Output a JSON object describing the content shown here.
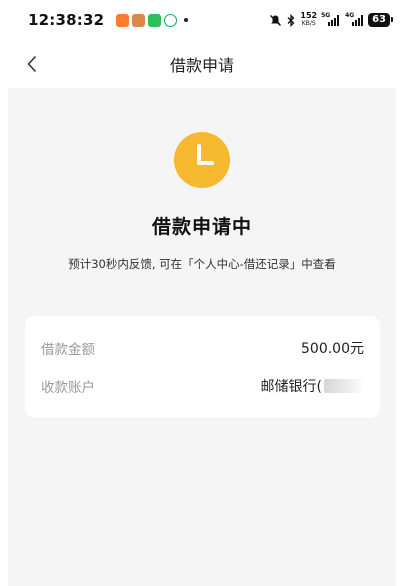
{
  "status_bar": {
    "time": "12:38:32",
    "net_speed_value": "152",
    "net_speed_unit": "KB/S",
    "battery": "63",
    "signal_tag_1": "5G",
    "signal_tag_2": "4G"
  },
  "nav": {
    "title": "借款申请"
  },
  "status": {
    "title": "借款申请中",
    "description": "预计30秒内反馈, 可在「个人中心-借还记录」中查看",
    "icon_color": "#f5b82e"
  },
  "details": {
    "amount_label": "借款金额",
    "amount_value": "500.00元",
    "account_label": "收款账户",
    "account_value": "邮储银行("
  }
}
